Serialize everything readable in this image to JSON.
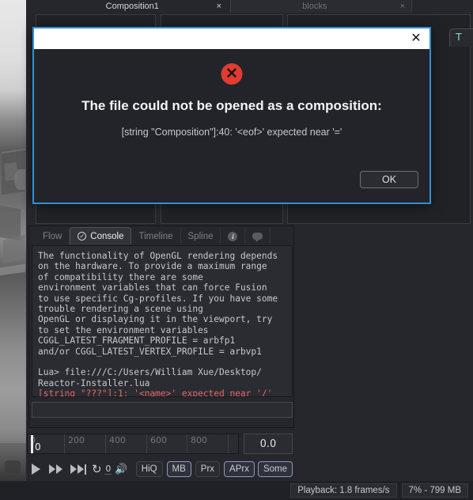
{
  "window": {
    "tabs": [
      {
        "label": "Composition1",
        "close": "×",
        "active": true
      },
      {
        "label": "blocks",
        "close": "×",
        "active": false
      }
    ],
    "node_label": "T",
    "dropdown_icon": "chevron-down-icon"
  },
  "dialog": {
    "title": "",
    "close_label": "✕",
    "icon": "error-icon",
    "icon_glyph": "✕",
    "heading": "The file could not be opened as a composition:",
    "detail": "[string \"Composition\"]:40: '<eof>' expected near '='",
    "ok_label": "OK",
    "accent_color": "#2f8fd6",
    "error_color": "#e03c31"
  },
  "console": {
    "tabs": [
      {
        "label": "Flow",
        "icon": "",
        "active": false
      },
      {
        "label": "Console",
        "icon": "check-circle-icon",
        "active": true
      },
      {
        "label": "Timeline",
        "icon": "",
        "active": false
      },
      {
        "label": "Spline",
        "icon": "",
        "active": false
      },
      {
        "label": "",
        "icon": "info-icon",
        "active": false
      },
      {
        "label": "",
        "icon": "comment-bubble-icon",
        "active": false
      }
    ],
    "output": "The functionality of OpenGL rendering depends\non the hardware. To provide a maximum range\nof compatibility there are some\nenvironment variables that can force Fusion\nto use specific Cg-profiles. If you have some\ntrouble rendering a scene using\nOpenGL or displaying it in the viewport, try\nto set the environment variables\nCGGL_LATEST_FRAGMENT_PROFILE = arbfp1\nand/or CGGL_LATEST_VERTEX_PROFILE = arbvp1",
    "command": "Lua> file:///C:/Users/William Xue/Desktop/\nReactor-Installer.lua",
    "error": "[string \"???\"]:1: '<name>' expected near '/'",
    "error_color": "#e0686b",
    "input_value": "",
    "input_placeholder": ""
  },
  "timeline": {
    "tick_labels": [
      "0",
      "200",
      "400",
      "600",
      "800"
    ],
    "playhead_value": "0",
    "time_field_value": "0.0"
  },
  "transport": {
    "buttons": [
      {
        "name": "play-button",
        "icon": "play-icon"
      },
      {
        "name": "fast-forward-button",
        "icon": "fast-forward-icon"
      },
      {
        "name": "skip-to-end-button",
        "icon": "skip-end-icon"
      },
      {
        "name": "loop-button",
        "icon": "loop-icon"
      }
    ],
    "loop_glyph": "↻",
    "frame_count": "0",
    "audio_glyph": "🔊",
    "quality_buttons": [
      {
        "label": "HiQ",
        "state": "off"
      },
      {
        "label": "MB",
        "state": "on"
      },
      {
        "label": "Prx",
        "state": "off"
      },
      {
        "label": "APrx",
        "state": "on"
      },
      {
        "label": "Some",
        "state": "on"
      }
    ]
  },
  "status": {
    "playback": "Playback: 1.8 frames/s",
    "memory": "7% -  799 MB"
  }
}
